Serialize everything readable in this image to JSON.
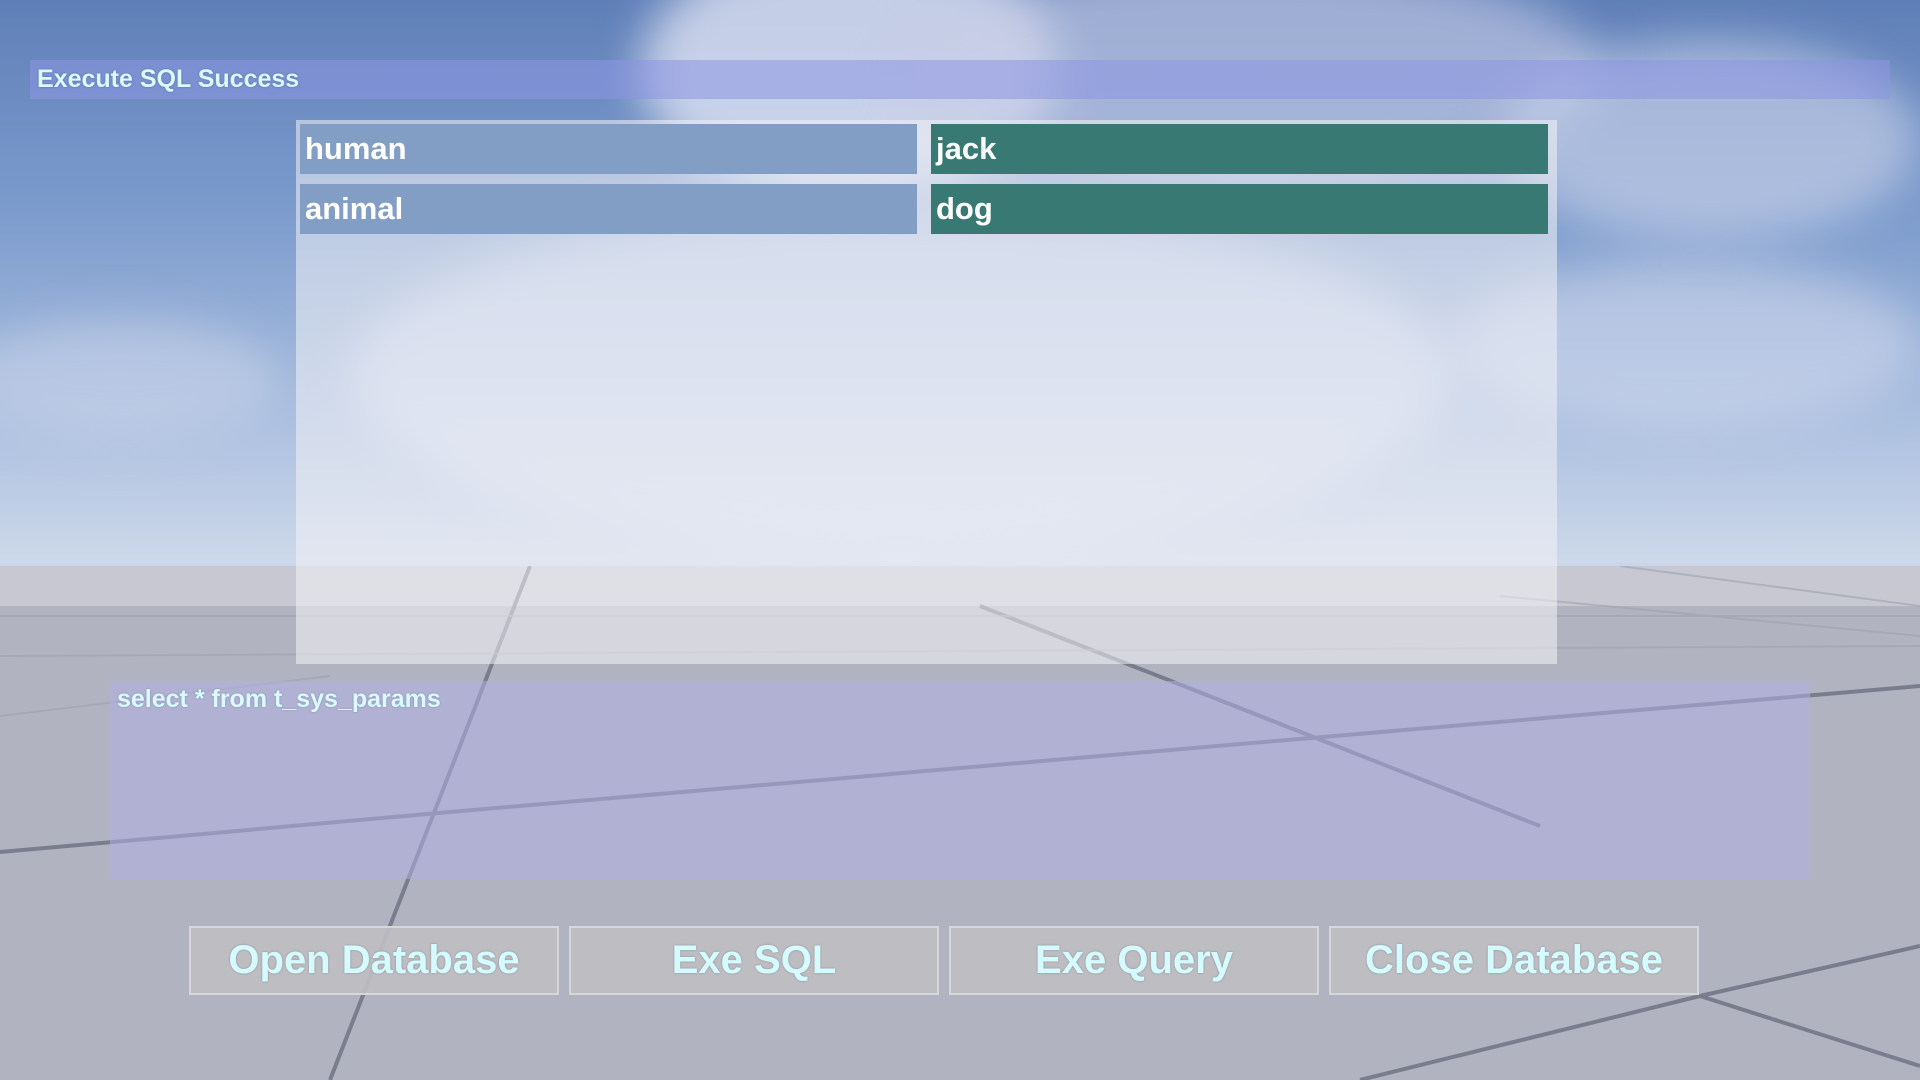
{
  "status": {
    "message": "Execute SQL Success"
  },
  "results": {
    "rows": [
      {
        "key": "human",
        "value": "jack"
      },
      {
        "key": "animal",
        "value": "dog"
      }
    ]
  },
  "sql_input": {
    "value": "select * from t_sys_params"
  },
  "buttons": {
    "open_database": "Open Database",
    "exe_sql": "Exe SQL",
    "exe_query": "Exe Query",
    "close_database": "Close Database"
  },
  "colors": {
    "key_cell": "#839ec5",
    "value_cell": "#387a73",
    "text_cyan": "#d8fbff"
  }
}
